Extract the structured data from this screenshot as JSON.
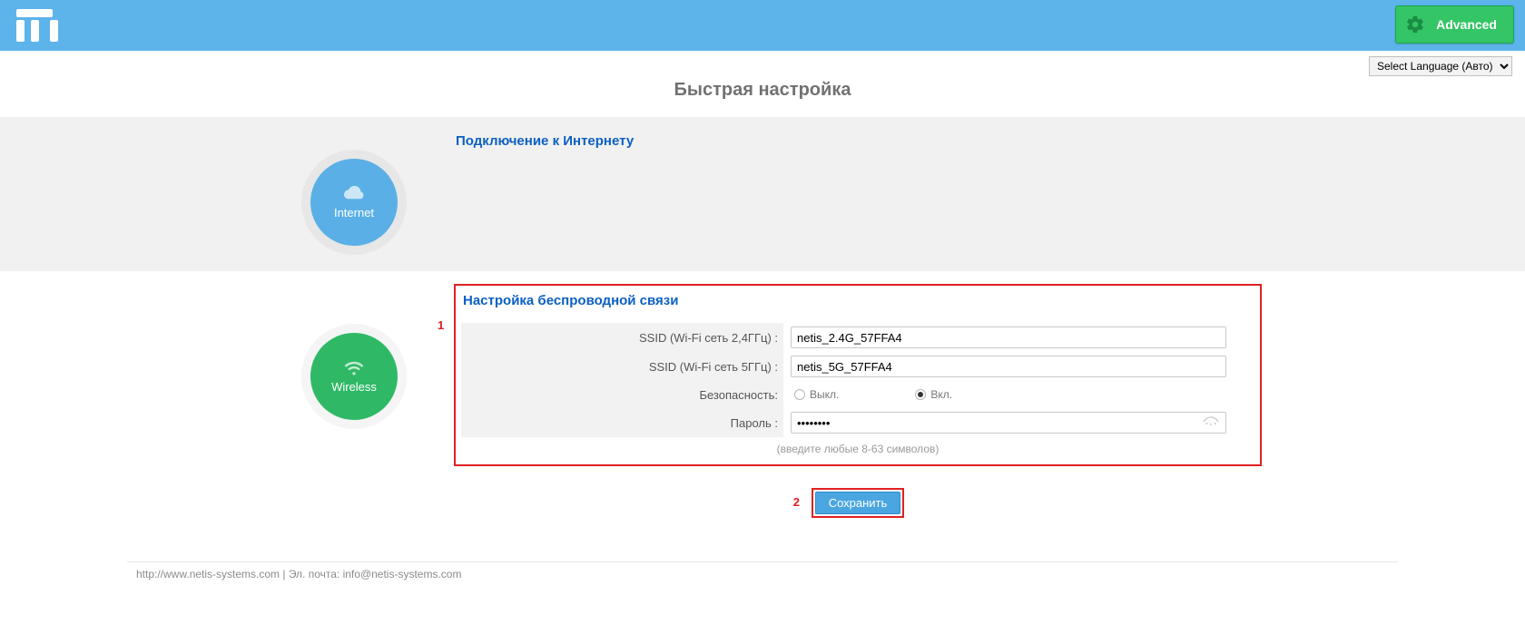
{
  "header": {
    "advanced_label": "Advanced",
    "language_selected": "Select Language (Авто)"
  },
  "page_title": "Быстрая настройка",
  "circles": {
    "internet_label": "Internet",
    "wireless_label": "Wireless"
  },
  "internet": {
    "title": "Подключение к Интернету"
  },
  "wireless": {
    "title": "Настройка беспроводной связи",
    "marker1": "1",
    "ssid24_label": "SSID (Wi-Fi сеть 2,4ГГц) :",
    "ssid24_value": "netis_2.4G_57FFA4",
    "ssid5_label": "SSID (Wi-Fi сеть 5ГГц) :",
    "ssid5_value": "netis_5G_57FFA4",
    "security_label": "Безопасность:",
    "security_off": "Выкл.",
    "security_on": "Вкл.",
    "password_label": "Пароль :",
    "password_value": "••••••••",
    "password_hint": "(введите любые 8-63 символов)"
  },
  "actions": {
    "marker2": "2",
    "save_label": "Сохранить"
  },
  "footer": {
    "site_url": "http://www.netis-systems.com",
    "email_prefix": " | Эл. почта: ",
    "email": "info@netis-systems.com"
  }
}
